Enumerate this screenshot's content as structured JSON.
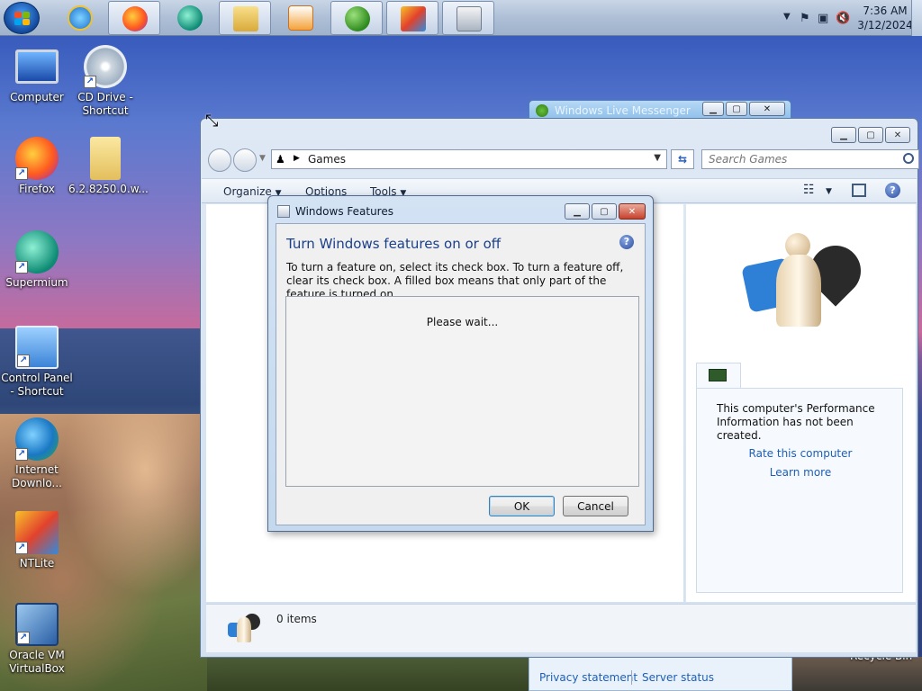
{
  "taskbar": {
    "clock_time": "7:36 AM",
    "clock_date": "3/12/2024",
    "buttons": [
      "internet-explorer-icon",
      "firefox-icon",
      "supermium-icon",
      "file-explorer-icon",
      "media-player-icon",
      "messenger-icon",
      "ntlite-icon",
      "programs-installer-icon"
    ]
  },
  "desktop": {
    "icons": [
      {
        "label": "Computer"
      },
      {
        "label": "CD Drive - Shortcut"
      },
      {
        "label": "Firefox"
      },
      {
        "label": "6.2.8250.0.w..."
      },
      {
        "label": "Supermium"
      },
      {
        "label": "Control Panel - Shortcut"
      },
      {
        "label": "Internet Downlo..."
      },
      {
        "label": "NTLite"
      },
      {
        "label": "Oracle VM VirtualBox"
      }
    ],
    "recycle_label": "Recycle Bin"
  },
  "messenger": {
    "title": "Windows Live Messenger",
    "privacy": "Privacy statement",
    "server": "Server status"
  },
  "explorer": {
    "address": "Games",
    "search_placeholder": "Search Games",
    "commands": {
      "organize": "Organize",
      "options": "Options",
      "tools": "Tools"
    },
    "perf_message": "This computer's Performance Information has not been created.",
    "rate_link": "Rate this computer",
    "learn_link": "Learn more",
    "items_count": "0 items"
  },
  "dialog": {
    "title": "Windows Features",
    "heading": "Turn Windows features on or off",
    "description": "To turn a feature on, select its check box. To turn a feature off, clear its check box. A filled box means that only part of the feature is turned on.",
    "wait": "Please wait...",
    "ok": "OK",
    "cancel": "Cancel"
  },
  "colors": {
    "accent": "#1b3f8a",
    "link": "#1f5fb3"
  }
}
